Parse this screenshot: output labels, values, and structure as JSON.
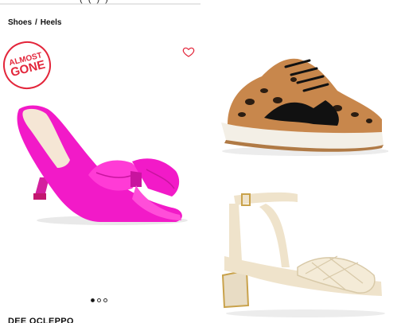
{
  "top_strip": {
    "cut_text": "( ( ) )"
  },
  "breadcrumb": {
    "items": [
      "Shoes",
      "Heels"
    ],
    "separator": "/"
  },
  "left_product": {
    "badge": {
      "line1": "ALMOST",
      "line2": "GONE"
    },
    "brand": "DEE OCLEPPO",
    "carousel": {
      "total": 3,
      "active": 1
    },
    "colors": {
      "badge": "#e3263b",
      "shoe": "#f21ac8"
    }
  },
  "right_products": [
    {
      "icon": "leopard-sneaker-image"
    },
    {
      "icon": "cream-sandal-image"
    }
  ],
  "icons": {
    "favorite": "heart-outline-icon"
  }
}
